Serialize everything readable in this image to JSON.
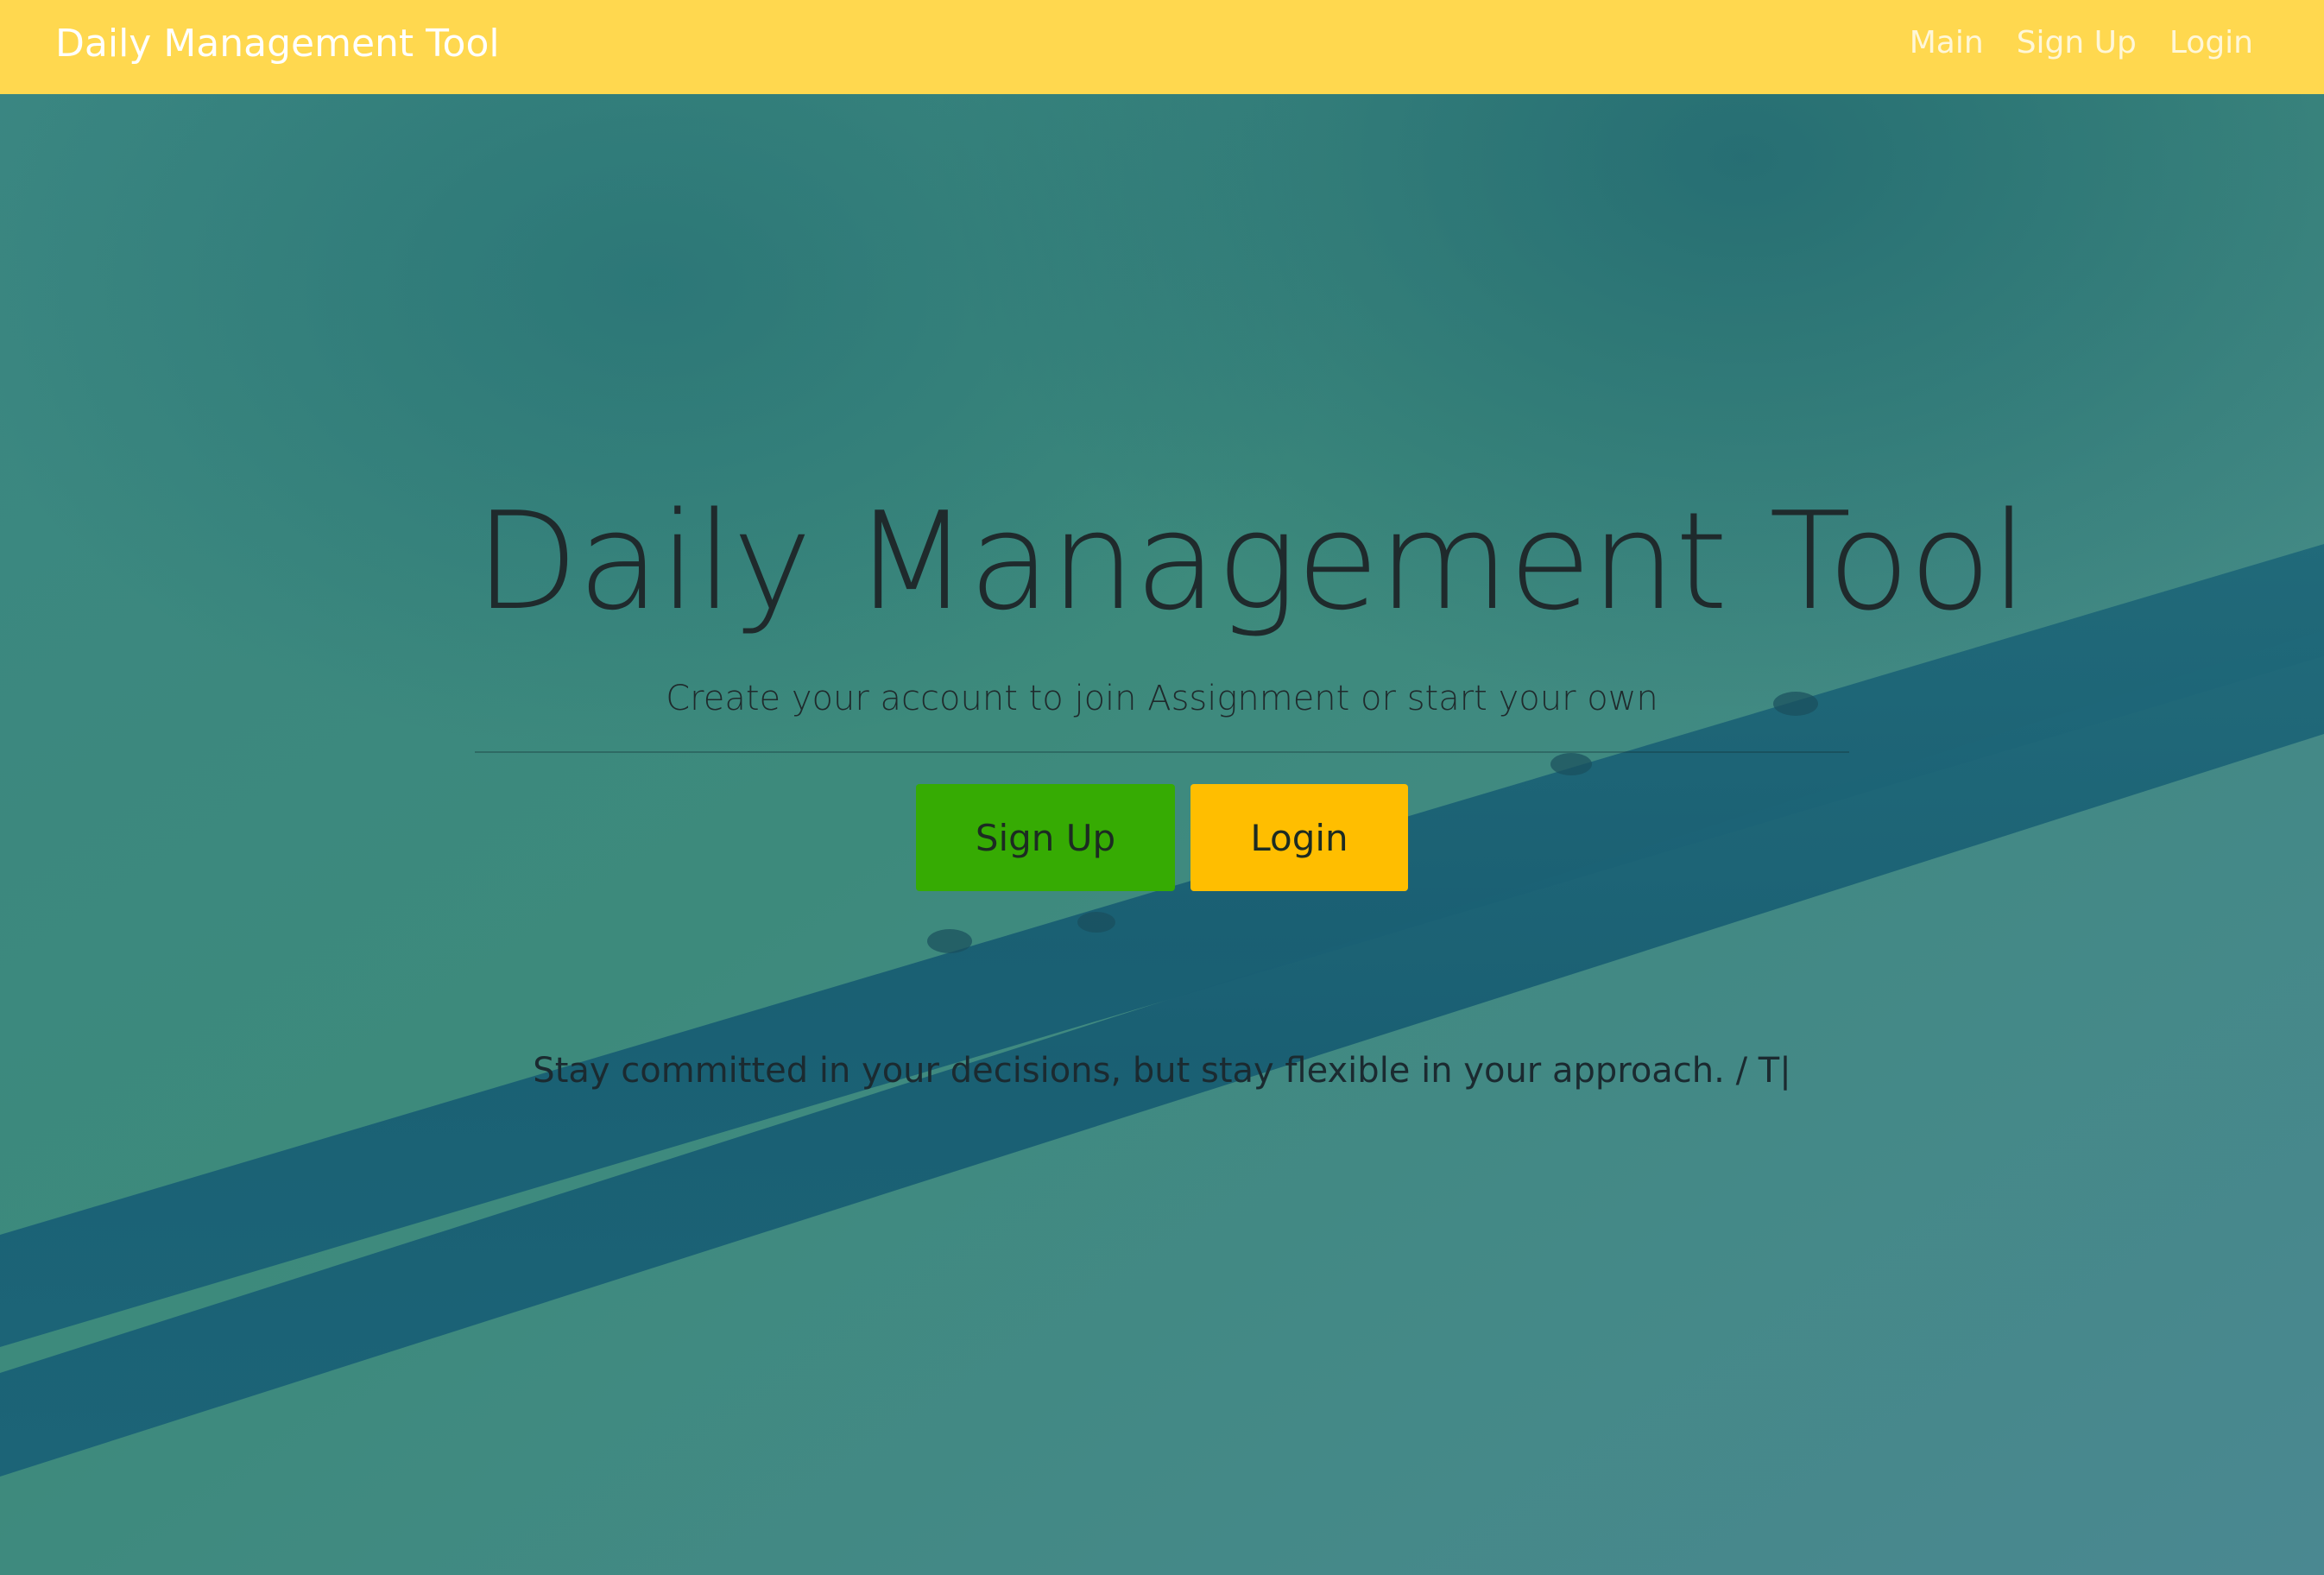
{
  "navbar": {
    "brand": "Daily Management Tool",
    "links": [
      "Main",
      "Sign Up",
      "Login"
    ]
  },
  "hero": {
    "title": "Daily Management Tool",
    "subtitle": "Create your account to join Assignment or start your own",
    "signup_label": "Sign Up",
    "login_label": "Login",
    "quote": "Stay committed in your decisions, but stay flexible in your approach. / T|"
  },
  "colors": {
    "navbar": "#ffd84f",
    "signup_button": "#36ab03",
    "login_button": "#ffbe00",
    "background": "#3f8a8a"
  }
}
